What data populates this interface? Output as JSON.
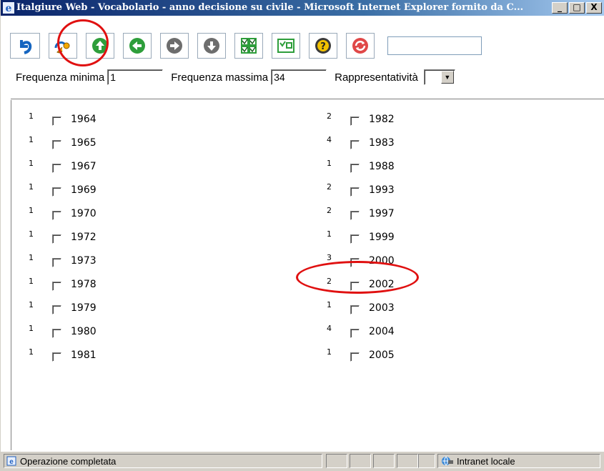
{
  "window": {
    "title": "Italgiure Web - Vocabolario - anno decisione su civile - Microsoft Internet Explorer fornito da C...",
    "minimize_label": "_",
    "maximize_label": "□",
    "close_label": "X"
  },
  "toolbar": {
    "buttons": [
      "undo-icon",
      "key-icon",
      "arrow-up-icon",
      "arrow-left-icon",
      "arrow-right-icon",
      "arrow-down-icon",
      "select-all-icon",
      "swap-icon",
      "help-icon",
      "refresh-icon"
    ],
    "search_value": ""
  },
  "filters": {
    "freq_min_label": "Frequenza minima",
    "freq_min_value": "1",
    "freq_max_label": "Frequenza massima",
    "freq_max_value": "34",
    "representativity_label": "Rappresentatività",
    "representativity_value": ""
  },
  "years_left": [
    {
      "freq": "1",
      "year": "1964"
    },
    {
      "freq": "1",
      "year": "1965"
    },
    {
      "freq": "1",
      "year": "1967"
    },
    {
      "freq": "1",
      "year": "1969"
    },
    {
      "freq": "1",
      "year": "1970"
    },
    {
      "freq": "1",
      "year": "1972"
    },
    {
      "freq": "1",
      "year": "1973"
    },
    {
      "freq": "1",
      "year": "1978"
    },
    {
      "freq": "1",
      "year": "1979"
    },
    {
      "freq": "1",
      "year": "1980"
    },
    {
      "freq": "1",
      "year": "1981"
    }
  ],
  "years_right": [
    {
      "freq": "2",
      "year": "1982"
    },
    {
      "freq": "4",
      "year": "1983"
    },
    {
      "freq": "1",
      "year": "1988"
    },
    {
      "freq": "2",
      "year": "1993"
    },
    {
      "freq": "2",
      "year": "1997"
    },
    {
      "freq": "1",
      "year": "1999"
    },
    {
      "freq": "3",
      "year": "2000"
    },
    {
      "freq": "2",
      "year": "2002"
    },
    {
      "freq": "1",
      "year": "2003"
    },
    {
      "freq": "4",
      "year": "2004"
    },
    {
      "freq": "1",
      "year": "2005"
    }
  ],
  "status": {
    "text": "Operazione completata",
    "zone": "Intranet locale"
  },
  "colors": {
    "annotation": "#e01010",
    "titlebar": "#0a246a"
  }
}
